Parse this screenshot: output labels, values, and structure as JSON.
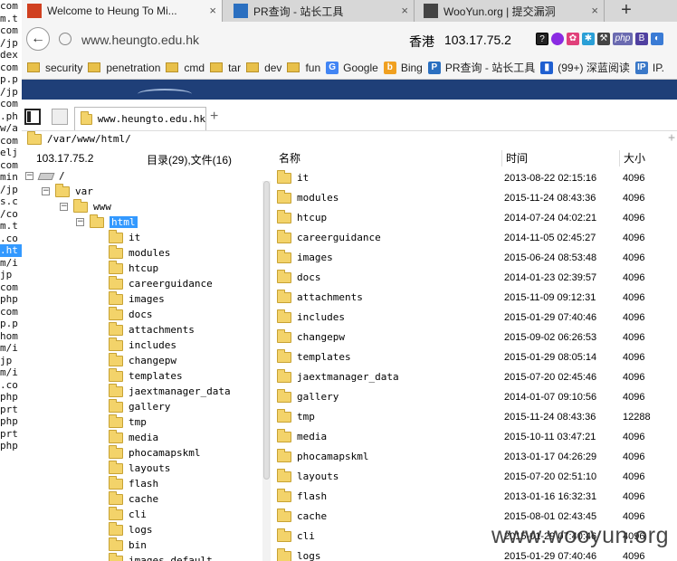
{
  "left_strip": [
    "com",
    "m.t",
    "com",
    "/jp",
    "dex",
    "com",
    "p.p",
    "/jp",
    "com",
    ".ph",
    "w/a",
    "com",
    "elj",
    "com",
    "min",
    "/jp",
    "s.c",
    "/co",
    "m.t",
    ".co",
    ".ht",
    "m/i",
    "jp",
    "com",
    "php",
    "com",
    "p.p",
    "hom",
    "m/i",
    "jp",
    "m/i",
    ".co",
    "php",
    "prt",
    "php",
    "prt",
    "php"
  ],
  "browser_tabs": [
    {
      "title": "Welcome to Heung To Mi...",
      "fav_color": "#d04020"
    },
    {
      "title": "PR查询 - 站长工具",
      "fav_color": "#2a6fc0"
    },
    {
      "title": "WooYun.org | 提交漏洞",
      "fav_color": "#444444"
    }
  ],
  "new_tab_label": "+",
  "close_label": "×",
  "back_label": "←",
  "address": {
    "url": "www.heungto.edu.hk",
    "region": "香港",
    "ip": "103.17.75.2"
  },
  "bookmarks": [
    {
      "label": "security",
      "kind": "folder"
    },
    {
      "label": "penetration",
      "kind": "folder"
    },
    {
      "label": "cmd",
      "kind": "folder"
    },
    {
      "label": "tar",
      "kind": "folder"
    },
    {
      "label": "dev",
      "kind": "folder"
    },
    {
      "label": "fun",
      "kind": "folder"
    },
    {
      "label": "Google",
      "kind": "site",
      "badge": "G",
      "color": "#4285f4"
    },
    {
      "label": "Bing",
      "kind": "site",
      "badge": "b",
      "color": "#f0a020"
    },
    {
      "label": "PR查询 - 站长工具",
      "kind": "site",
      "badge": "P",
      "color": "#2a6fc0"
    },
    {
      "label": "(99+) 深蓝阅读",
      "kind": "site",
      "badge": "▮",
      "color": "#1f5fd0"
    },
    {
      "label": "IP.",
      "kind": "site",
      "badge": "IP",
      "color": "#3a78c8"
    }
  ],
  "app": {
    "tab_title": "www.heungto.edu.hk",
    "add_tab": "+",
    "path": "/var/www/html/",
    "path_plus": "+",
    "server_ip": "103.17.75.2",
    "counts": "目录(29),文件(16)"
  },
  "tree": [
    {
      "label": "/",
      "level": 0,
      "kind": "drive",
      "expander": "⊟"
    },
    {
      "label": "var",
      "level": 1,
      "kind": "folder",
      "expander": "⊟"
    },
    {
      "label": "www",
      "level": 2,
      "kind": "folder",
      "expander": "⊟"
    },
    {
      "label": "html",
      "level": 3,
      "kind": "folder",
      "expander": "⊟",
      "selected": true
    },
    {
      "label": "it",
      "level": 4,
      "kind": "folder"
    },
    {
      "label": "modules",
      "level": 4,
      "kind": "folder"
    },
    {
      "label": "htcup",
      "level": 4,
      "kind": "folder"
    },
    {
      "label": "careerguidance",
      "level": 4,
      "kind": "folder"
    },
    {
      "label": "images",
      "level": 4,
      "kind": "folder"
    },
    {
      "label": "docs",
      "level": 4,
      "kind": "folder"
    },
    {
      "label": "attachments",
      "level": 4,
      "kind": "folder"
    },
    {
      "label": "includes",
      "level": 4,
      "kind": "folder"
    },
    {
      "label": "changepw",
      "level": 4,
      "kind": "folder"
    },
    {
      "label": "templates",
      "level": 4,
      "kind": "folder"
    },
    {
      "label": "jaextmanager_data",
      "level": 4,
      "kind": "folder"
    },
    {
      "label": "gallery",
      "level": 4,
      "kind": "folder"
    },
    {
      "label": "tmp",
      "level": 4,
      "kind": "folder"
    },
    {
      "label": "media",
      "level": 4,
      "kind": "folder"
    },
    {
      "label": "phocamapskml",
      "level": 4,
      "kind": "folder"
    },
    {
      "label": "layouts",
      "level": 4,
      "kind": "folder"
    },
    {
      "label": "flash",
      "level": 4,
      "kind": "folder"
    },
    {
      "label": "cache",
      "level": 4,
      "kind": "folder"
    },
    {
      "label": "cli",
      "level": 4,
      "kind": "folder"
    },
    {
      "label": "logs",
      "level": 4,
      "kind": "folder"
    },
    {
      "label": "bin",
      "level": 4,
      "kind": "folder"
    },
    {
      "label": "images_default",
      "level": 4,
      "kind": "folder"
    }
  ],
  "list": {
    "columns": [
      "名称",
      "时间",
      "大小"
    ],
    "rows": [
      {
        "name": "it",
        "time": "2013-08-22 02:15:16",
        "size": "4096"
      },
      {
        "name": "modules",
        "time": "2015-11-24 08:43:36",
        "size": "4096"
      },
      {
        "name": "htcup",
        "time": "2014-07-24 04:02:21",
        "size": "4096"
      },
      {
        "name": "careerguidance",
        "time": "2014-11-05 02:45:27",
        "size": "4096"
      },
      {
        "name": "images",
        "time": "2015-06-24 08:53:48",
        "size": "4096"
      },
      {
        "name": "docs",
        "time": "2014-01-23 02:39:57",
        "size": "4096"
      },
      {
        "name": "attachments",
        "time": "2015-11-09 09:12:31",
        "size": "4096"
      },
      {
        "name": "includes",
        "time": "2015-01-29 07:40:46",
        "size": "4096"
      },
      {
        "name": "changepw",
        "time": "2015-09-02 06:26:53",
        "size": "4096"
      },
      {
        "name": "templates",
        "time": "2015-01-29 08:05:14",
        "size": "4096"
      },
      {
        "name": "jaextmanager_data",
        "time": "2015-07-20 02:45:46",
        "size": "4096"
      },
      {
        "name": "gallery",
        "time": "2014-01-07 09:10:56",
        "size": "4096"
      },
      {
        "name": "tmp",
        "time": "2015-11-24 08:43:36",
        "size": "12288"
      },
      {
        "name": "media",
        "time": "2015-10-11 03:47:21",
        "size": "4096"
      },
      {
        "name": "phocamapskml",
        "time": "2013-01-17 04:26:29",
        "size": "4096"
      },
      {
        "name": "layouts",
        "time": "2015-07-20 02:51:10",
        "size": "4096"
      },
      {
        "name": "flash",
        "time": "2013-01-16 16:32:31",
        "size": "4096"
      },
      {
        "name": "cache",
        "time": "2015-08-01 02:43:45",
        "size": "4096"
      },
      {
        "name": "cli",
        "time": "2015-01-29 07:40:46",
        "size": "4096"
      },
      {
        "name": "logs",
        "time": "2015-01-29 07:40:46",
        "size": "4096"
      }
    ]
  },
  "watermark": "www.wooyun.org"
}
